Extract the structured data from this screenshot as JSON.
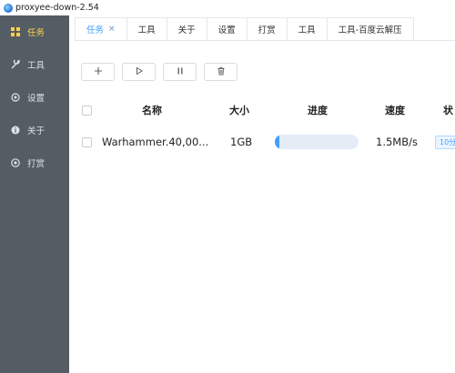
{
  "window": {
    "title": "proxyee-down-2.54"
  },
  "sidebar": {
    "items": [
      {
        "label": "任务",
        "icon": "grid-icon",
        "active": true
      },
      {
        "label": "工具",
        "icon": "wrench-icon",
        "active": false
      },
      {
        "label": "设置",
        "icon": "settings-icon",
        "active": false
      },
      {
        "label": "关于",
        "icon": "info-icon",
        "active": false
      },
      {
        "label": "打赏",
        "icon": "circle-dot-icon",
        "active": false
      }
    ]
  },
  "tabs": [
    {
      "label": "任务",
      "closable": true,
      "active": true
    },
    {
      "label": "工具"
    },
    {
      "label": "关于"
    },
    {
      "label": "设置"
    },
    {
      "label": "打赏"
    },
    {
      "label": "工具"
    },
    {
      "label": "工具-百度云解压"
    }
  ],
  "tab_close_glyph": "×",
  "toolbar": {
    "buttons": [
      {
        "name": "add",
        "icon": "plus-icon"
      },
      {
        "name": "start",
        "icon": "play-icon"
      },
      {
        "name": "pause",
        "icon": "pause-icon"
      },
      {
        "name": "delete",
        "icon": "trash-icon"
      }
    ]
  },
  "table": {
    "headers": {
      "name": "名称",
      "size": "大小",
      "progress": "进度",
      "speed": "速度",
      "status": "状"
    },
    "rows": [
      {
        "name": "Warhammer.40,00...",
        "size": "1GB",
        "progress": 0.05,
        "speed": "1.5MB/s",
        "status": "10分"
      }
    ]
  },
  "colors": {
    "sidebar_bg": "#545c64",
    "sidebar_active": "#ffd04b",
    "accent": "#409eff"
  }
}
